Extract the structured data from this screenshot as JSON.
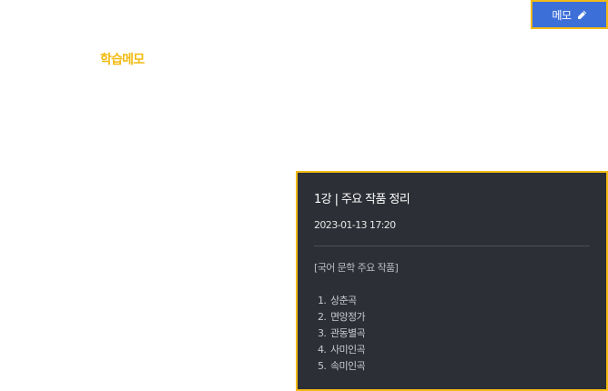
{
  "header": {
    "memo_button_label": "메모",
    "memo_button_icon": "pencil-icon"
  },
  "section": {
    "title": "학습메모"
  },
  "memo": {
    "title": "1강 | 주요 작품 정리",
    "date": "2023-01-13  17:20",
    "category": "[국어 문학 주요 작품]",
    "items": [
      {
        "num": "1.",
        "label": "상춘곡"
      },
      {
        "num": "2.",
        "label": "면앙정가"
      },
      {
        "num": "3.",
        "label": "관동별곡"
      },
      {
        "num": "4.",
        "label": "사미인곡"
      },
      {
        "num": "5.",
        "label": "속미인곡"
      }
    ]
  },
  "colors": {
    "accent": "#f3bb14",
    "button": "#3d6fd9",
    "panel": "#2d2f36"
  }
}
